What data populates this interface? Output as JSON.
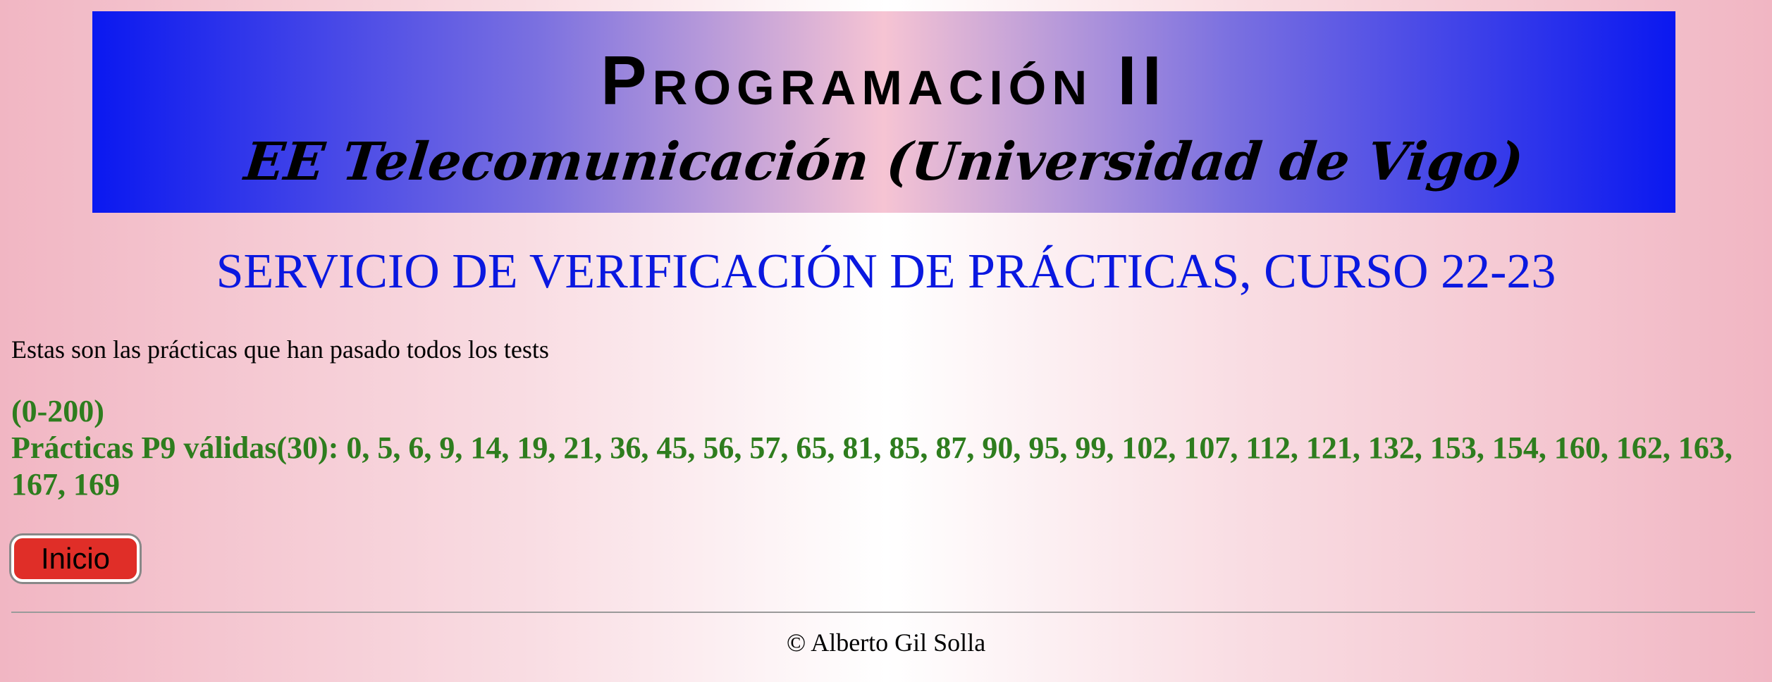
{
  "banner": {
    "title": "Programación II",
    "subtitle": "EE Telecomunicación (Universidad de Vigo)"
  },
  "heading": "SERVICIO DE VERIFICACIÓN DE PRÁCTICAS, CURSO 22-23",
  "intro": "Estas son las prácticas que han pasado todos los tests",
  "results": {
    "range": "(0-200)",
    "practices_line": "Prácticas P9 válidas(30): 0, 5, 6, 9, 14, 19, 21, 36, 45, 56, 57, 65, 81, 85, 87, 90, 95, 99, 102, 107, 112, 121, 132, 153, 154, 160, 162, 163, 167, 169"
  },
  "buttons": {
    "inicio_label": "Inicio"
  },
  "footer": {
    "copyright": "© Alberto Gil Solla"
  },
  "colors": {
    "heading": "#0a18e0",
    "results": "#2e7d1e",
    "button": "#e02e28",
    "banner_edge": "#0a18f0"
  }
}
